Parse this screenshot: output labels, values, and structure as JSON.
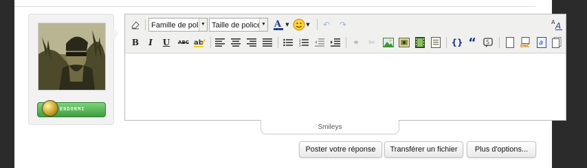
{
  "profile": {
    "status_label": "ENDORMI",
    "avatar_alt": "avatar"
  },
  "editor": {
    "font_family": {
      "value": "Famille de police"
    },
    "font_size": {
      "value": "Taille de police"
    },
    "icons_row1": [
      "eraser-icon",
      "text-color-icon",
      "smiley-icon",
      "undo-icon",
      "redo-icon",
      "font-resize-icon"
    ],
    "icons_row2": [
      "bold-icon",
      "italic-icon",
      "underline-icon",
      "strikethrough-icon",
      "highlight-icon",
      "align-left-icon",
      "align-center-icon",
      "align-right-icon",
      "justify-icon",
      "bullet-list-icon",
      "numbered-list-icon",
      "outdent-icon",
      "indent-icon",
      "link-icon",
      "unlink-icon",
      "image-icon",
      "gallery-icon",
      "video-icon",
      "document-icon",
      "code-icon",
      "quote-icon",
      "spoiler-icon",
      "new-page-icon",
      "encode-icon",
      "text-icon",
      "copy-icon"
    ],
    "bold_glyph": "B",
    "italic_glyph": "I",
    "underline_glyph": "U",
    "strike_glyph": "ABC",
    "quote_glyph": "“"
  },
  "smileys_tab": {
    "label": "Smileys"
  },
  "actions": {
    "post_label": "Poster votre réponse",
    "upload_label": "Transférer un fichier",
    "more_label": "Plus d'options..."
  }
}
